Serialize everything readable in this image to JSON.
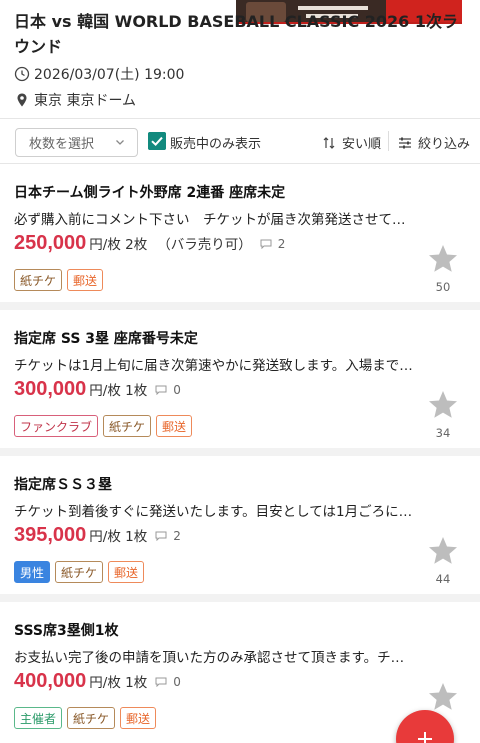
{
  "event": {
    "title": "日本 vs 韓国 WORLD BASEBALL CLASSIC 2026 1次ラウンド",
    "datetime": "2026/03/07(土) 19:00",
    "venue": "東京 東京ドーム",
    "icons": {
      "clock": "clock-icon",
      "location": "map-pin-icon"
    }
  },
  "filters": {
    "quantity_placeholder": "枚数を選択",
    "on_sale_only_label": "販売中のみ表示",
    "on_sale_only_checked": true,
    "sort_label": "安い順",
    "filter_label": "絞り込み"
  },
  "listings": [
    {
      "title": "日本チーム側ライト外野席 2連番 座席未定",
      "description": "必ず購入前にコメント下さい　チケットが届き次第発送させて…",
      "price": "250,000",
      "unit": "円/枚 2枚",
      "note": "（バラ売り可）",
      "comments": "2",
      "tags": [
        {
          "label": "紙チケ",
          "kind": "paper"
        },
        {
          "label": "郵送",
          "kind": "post"
        }
      ],
      "favorites": "50"
    },
    {
      "title": "指定席 SS 3塁  座席番号未定",
      "description": "チケットは1月上旬に届き次第速やかに発送致します。入場まで…",
      "price": "300,000",
      "unit": "円/枚 1枚",
      "note": "",
      "comments": "0",
      "tags": [
        {
          "label": "ファンクラブ",
          "kind": "fan"
        },
        {
          "label": "紙チケ",
          "kind": "paper"
        },
        {
          "label": "郵送",
          "kind": "post"
        }
      ],
      "favorites": "34"
    },
    {
      "title": "指定席ＳＳ３塁",
      "description": "チケット到着後すぐに発送いたします。目安としては1月ごろに…",
      "price": "395,000",
      "unit": "円/枚 1枚",
      "note": "",
      "comments": "2",
      "tags": [
        {
          "label": "男性",
          "kind": "male"
        },
        {
          "label": "紙チケ",
          "kind": "paper"
        },
        {
          "label": "郵送",
          "kind": "post"
        }
      ],
      "favorites": "44"
    },
    {
      "title": "SSS席3塁側1枚",
      "description": "お支払い完了後の申請を頂いた方のみ承認させて頂きます。チ…",
      "price": "400,000",
      "unit": "円/枚 1枚",
      "note": "",
      "comments": "0",
      "tags": [
        {
          "label": "主催者",
          "kind": "org"
        },
        {
          "label": "紙チケ",
          "kind": "paper"
        },
        {
          "label": "郵送",
          "kind": "post"
        }
      ],
      "favorites": ""
    }
  ],
  "colors": {
    "price": "#d8334a",
    "accent_check": "#128a7e",
    "fab": "#e83a3a"
  }
}
